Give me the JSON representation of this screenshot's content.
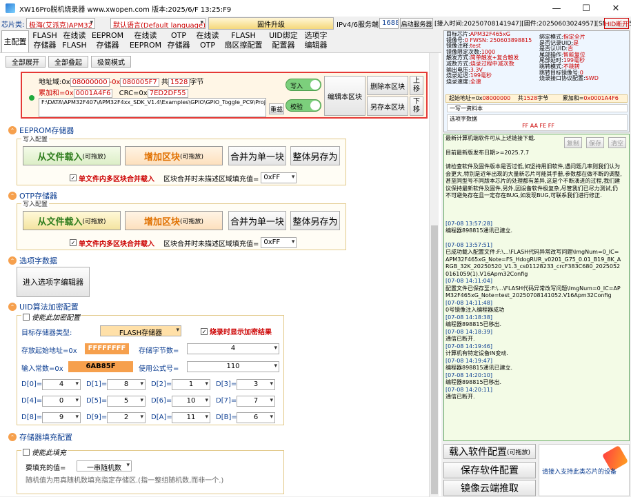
{
  "titlebar": {
    "title": "XW16Pro脱机烧录器      www.xwopen.com     版本:2025/6/F 13:25:F9",
    "minimize": "—",
    "maximize": "☐",
    "close": "✕"
  },
  "toolbar": {
    "chip_label": "芯片类:",
    "chip_value": "极海(艾派克)APM32",
    "lang_value": "默认语言(Default language)",
    "firmware_btn": "固件升级",
    "ip_label": "IPv4/6服务端口:",
    "port": "16888",
    "start_server": "启动服务器",
    "device_info": "[接入时间:20250708141947][固件:20250603024957][SN:898815]",
    "hid_btn": "HID断开"
  },
  "tabs": [
    {
      "label": "主配置"
    },
    {
      "label": "FLASH\n存储器"
    },
    {
      "label": "在线读\nFLASH"
    },
    {
      "label": "EEPROM\n存储器"
    },
    {
      "label": "在线读\nEEPROM"
    },
    {
      "label": "OTP\n存储器"
    },
    {
      "label": "在线读\nOTP"
    },
    {
      "label": "FLASH\n扇区擦配置"
    },
    {
      "label": "UID绑定\n配置器"
    },
    {
      "label": "选项字\n编辑器"
    }
  ],
  "topbar": {
    "expand_all": "全部展开",
    "collapse_all": "全部叠起",
    "simple_mode": "极简模式"
  },
  "flash_block": {
    "addr_label": "地址域:0x",
    "addr_start": "08000000",
    "addr_sep": "-0x",
    "addr_end": "080005F7",
    "total_label": "共",
    "total": "1528",
    "total_unit": "字节",
    "sum_label": "累加和=0x",
    "sum": "0001A4F6",
    "crc_label": "CRC=0x",
    "crc": "7ED2DF55",
    "path": "F:\\DATA\\APM32F407\\APM32F4xx_SDK_V1.4\\Examples\\GPIO\\GPIO_Toggle_PC9\\Project\\MDK\\Out\\APM32F407\\GPIO_Toggle.hex",
    "reload": "重载",
    "write": "写入",
    "verify": "校验",
    "edit_block": "编辑本区块",
    "delete_block": "删除本区块",
    "save_block": "另存本区块",
    "up": "上\n移",
    "down": "下\n移"
  },
  "eeprom": {
    "title": "EEPROM存储器",
    "group": "写入配置",
    "load": "从文件载入",
    "load_hint": "(可拖放)",
    "add": "增加区块",
    "add_hint": "(可拖放)",
    "merge": "合并为单一块",
    "saveall": "整体另存为",
    "checkbox": "单文件内多区块合并载入",
    "fill_label": "区块合并时未描述区域填充值=",
    "fill": "0xFF"
  },
  "otp": {
    "title": "OTP存储器",
    "group": "写入配置",
    "load": "从文件载入",
    "load_hint": "(可拖放)",
    "add": "增加区块",
    "add_hint": "(可拖放)",
    "merge": "合并为单一块",
    "saveall": "整体另存为",
    "checkbox": "单文件内多区块合并载入",
    "fill_label": "区块合并时未描述区域填充值=",
    "fill": "0xFF"
  },
  "option": {
    "title": "选项字数据",
    "enter": "进入选项字编辑器"
  },
  "uid": {
    "title": "UID算法加密配置",
    "enable": "使能此加密配置",
    "target_label": "目标存储器类型:",
    "target": "FLASH存储器",
    "show_label": "烧录时显示加密结果",
    "start_label": "存放起始地址=0x",
    "start": "FFFFFFFF",
    "bytes_label": "存储字节数=",
    "bytes": "4",
    "const_label": "输入常数=0x",
    "const": "6AB85F",
    "formula_label": "使用公式号=",
    "formula": "110",
    "d": [
      {
        "k": "D[0]=",
        "v": "4"
      },
      {
        "k": "D[1]=",
        "v": "8"
      },
      {
        "k": "D[2]=",
        "v": "1"
      },
      {
        "k": "D[3]=",
        "v": "3"
      },
      {
        "k": "D[4]=",
        "v": "0"
      },
      {
        "k": "D[5]=",
        "v": "5"
      },
      {
        "k": "D[6]=",
        "v": "10"
      },
      {
        "k": "D[7]=",
        "v": "7"
      },
      {
        "k": "D[8]=",
        "v": "9"
      },
      {
        "k": "D[9]=",
        "v": "2"
      },
      {
        "k": "D[A]=",
        "v": "11"
      },
      {
        "k": "D[B]=",
        "v": "6"
      }
    ]
  },
  "fillcfg": {
    "title": "存储器填充配置",
    "enable": "使能此填充",
    "value_label": "要填充的值=",
    "value": "一串随机数",
    "desc": "随机值为用真随机数填充指定存储区.(指一整组随机数,而非一个.)"
  },
  "info": {
    "lines": [
      [
        "目标芯片:",
        "APM32F465xG"
      ],
      [
        "镜像号:",
        "0 FWSN: 250603898815"
      ],
      [
        "镜像注释:",
        "test"
      ],
      [
        "镜像限定次数:",
        "1000"
      ],
      [
        "触发方式:",
        "简单触发+复合触发"
      ],
      [
        "减数方式:",
        "烧录过程中减次数"
      ],
      [
        "输出电压:",
        "3.3V"
      ],
      [
        "烧录延迟:",
        "199毫秒"
      ],
      [
        "烧录速度:",
        "全速"
      ]
    ],
    "lines2": [
      [
        "绑定模式:",
        "指定全片"
      ],
      [
        "是否记录UID:",
        "是"
      ],
      [
        "是否认UID:",
        "否"
      ],
      [
        "尾部操作:",
        "智能复位"
      ],
      [
        "尾部延时:",
        "199毫秒"
      ],
      [
        "跳转模式:",
        "不跳转"
      ],
      [
        "跳转目标镜像号:",
        "0"
      ],
      [
        "烧录接口协议配置:",
        "SWD"
      ]
    ],
    "start_label": "起始地址=0x",
    "start": "08000000",
    "total_label": "共",
    "total": "1528",
    "total_unit": "字节",
    "sum_label": "累加和=",
    "sum": "0x0001A4F6",
    "script_title": "一写一资料本",
    "opt_title": "选项字数据",
    "opt_val": "FF AA FE FF"
  },
  "log": {
    "copy": "复制",
    "save": "保存",
    "clear": "清空",
    "lines": [
      "最新计算机端软件可从上述链接下载.",
      "",
      "目前最新版发布日期>=2025.7.7",
      "",
      "请检查软件及固件版本是否过低,如坚持用旧软件,遇问题几率则我们认为会更大,特别是近年出现的大量新芯片可能其手册,参数都在做不断的调整,甚至同型号不同版本芯片的处理都有差异,这是个不断演进的过程,我们建议保持最新软件及固件,另外,因设备软件极复杂,尽管我们已尽力测试,仍不可避免存在且一定存在BUG,如发现BUG,可联系我们进行修正.",
      "",
      "",
      "",
      "[07-08 13:57:28]",
      "编程器898815通讯已建立.",
      "",
      "[07-08 13:57:51]",
      "已成功载入配置文件:F:\\...\\FLASH代码异常改写问题\\ImgNum=0_IC=APM32F465xG_Note=FS_HdogRUR_v0201_G75_0.01_B19_8K_ARGB_32K_20250520_V1.3_cs01128233_crcF383C680_20250520161059(1).V16Apm32Config",
      "[07-08 14:11:04]",
      "配置文件已保存至:F:\\...\\FLASH代码异常改写问题\\ImgNum=0_IC=APM32F465xG_Note=test_20250708141052.V16Apm32Config",
      "[07-08 14:11:48]",
      "0号镜像注入编程器成功",
      "[07-08 14:18:38]",
      "编程器898815已移出.",
      "[07-08 14:18:39]",
      "通信已断开.",
      "[07-08 14:19:46]",
      "计算机有特定设备IN变动.",
      "[07-08 14:19:47]",
      "编程器898815通讯已建立.",
      "[07-08 14:20:10]",
      "编程器898815已移出.",
      "[07-08 14:20:11]",
      "通信已断开."
    ]
  },
  "bottom": {
    "load_cfg": "载入软件配置",
    "load_hint": "(可拖放)",
    "save_cfg": "保存软件配置",
    "cloud": "镜像云端推取",
    "link": "请接入支持此类芯片的设备"
  },
  "colors": {
    "accent": "#0b3d91",
    "red": "#c00000",
    "orange": "#f6a04d"
  }
}
